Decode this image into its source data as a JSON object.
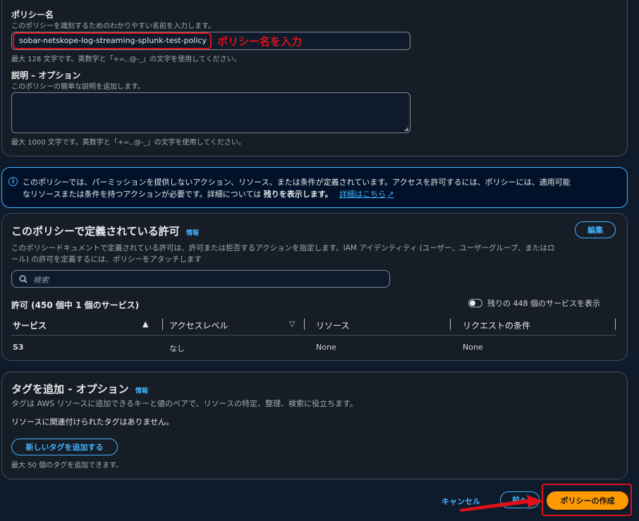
{
  "policy_name": {
    "label": "ポリシー名",
    "description": "このポリシーを識別するためのわかりやすい名前を入力します。",
    "value": "sobar-netskope-log-streaming-splunk-test-policy",
    "annotation": "ポリシー名を入力",
    "hint": "最大 128 文字です。英数字と「+=,.@-_」の文字を使用してください。"
  },
  "description_field": {
    "label": "説明 – オプション",
    "description": "このポリシーの簡単な説明を追加します。",
    "value": "",
    "hint": "最大 1000 文字です。英数字と「+=,.@-_」の文字を使用してください。"
  },
  "info_alert": {
    "line1": "このポリシーでは、パーミッションを提供しないアクション、リソース、または条件が定義されています。アクセスを許可するには、ポリシーには、適用可能",
    "line2_prefix": "なリソースまたは条件を持つアクションが必要です。詳細については ",
    "line2_bold": "残りを表示します。",
    "learn_more": "詳細はこちら"
  },
  "permissions": {
    "title": "このポリシーで定義されている許可",
    "info": "情報",
    "edit_label": "編集",
    "desc_line1": "このポリシードキュメントで定義されている許可は、許可または拒否するアクションを指定します。IAM アイデンティティ (ユーザー、ユーザーグループ、またはロ",
    "desc_line2": "ール) の許可を定義するには、ポリシーをアタッチします",
    "search_placeholder": "検索",
    "count_label": "許可 (450 個中 1 個のサービス)",
    "toggle_label": "残りの 448 個のサービスを表示",
    "columns": [
      "サービス",
      "アクセスレベル",
      "リソース",
      "リクエストの条件"
    ],
    "rows": [
      {
        "service": "S3",
        "access": "なし",
        "resource": "None",
        "condition": "None"
      }
    ]
  },
  "tags": {
    "title": "タグを追加 - オプション",
    "info": "情報",
    "description": "タグは AWS リソースに追加できるキーと値のペアで、リソースの特定、整理、検索に役立ちます。",
    "empty_text": "リソースに関連付けられたタグはありません。",
    "add_label": "新しいタグを追加する",
    "hint": "最大 50 個のタグを追加できます。"
  },
  "footer": {
    "cancel": "キャンセル",
    "back": "前へ",
    "create": "ポリシーの作成"
  },
  "colors": {
    "background": "#0f1b2a",
    "panel": "#161d26",
    "link": "#42b4ff",
    "primary": "#ff9900",
    "annotation": "#e0101a"
  }
}
